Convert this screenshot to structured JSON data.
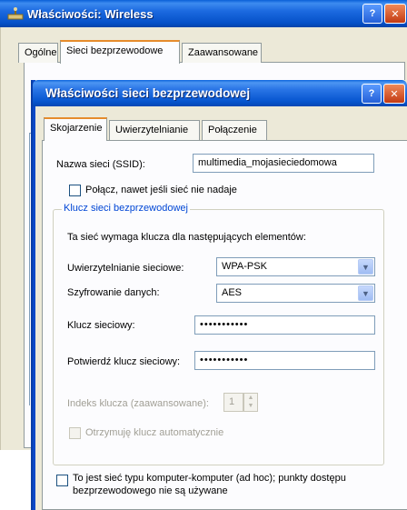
{
  "back_window": {
    "title": "Właściwości: Wireless",
    "tabs": [
      "Ogólne",
      "Sieci bezprzewodowe",
      "Zaawansowane"
    ],
    "help_icon": "question-icon",
    "close_icon": "close-icon"
  },
  "dialog": {
    "title": "Właściwości sieci bezprzewodowej",
    "tabs": [
      "Skojarzenie",
      "Uwierzytelnianie",
      "Połączenie"
    ],
    "ssid_label": "Nazwa sieci (SSID):",
    "ssid_value": "multimedia_mojasieciedomowa",
    "connect_hidden_label": "Połącz, nawet jeśli sieć nie nadaje",
    "group_title": "Klucz sieci bezprzewodowej",
    "group_desc": "Ta sieć wymaga klucza dla następujących elementów:",
    "auth_label": "Uwierzytelnianie sieciowe:",
    "auth_value": "WPA-PSK",
    "encryption_label": "Szyfrowanie danych:",
    "encryption_value": "AES",
    "key_label": "Klucz sieciowy:",
    "key_value": "•••••••••••",
    "confirm_label": "Potwierdź klucz sieciowy:",
    "confirm_value": "•••••••••••",
    "key_index_label": "Indeks klucza (zaawansowane):",
    "key_index_value": "1",
    "auto_key_label": "Otrzymuję klucz automatycznie",
    "adhoc_label_line1": "To jest sieć typu komputer-komputer (ad hoc); punkty dostępu",
    "adhoc_label_line2": "bezprzewodowego nie są używane",
    "help_button": "?",
    "close_button": "✕"
  },
  "colors": {
    "titlebar_blue": "#0756d0",
    "close_red": "#c23a12",
    "tab_highlight": "#e68b2c",
    "group_legend": "#0046d5"
  }
}
